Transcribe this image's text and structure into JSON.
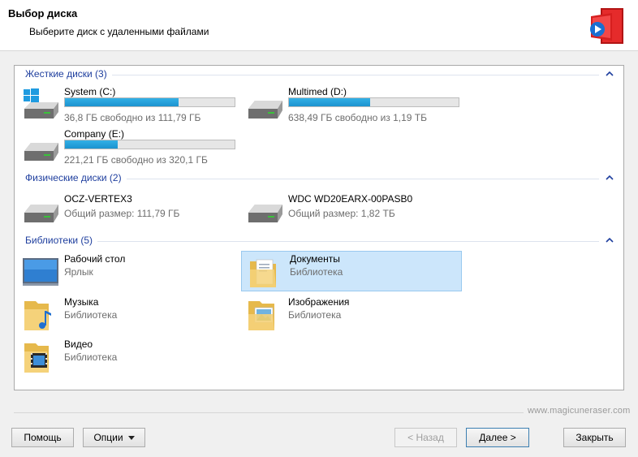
{
  "header": {
    "title": "Выбор диска",
    "subtitle": "Выберите диск с удаленными файлами"
  },
  "groups": {
    "hard": {
      "label": "Жесткие диски (3)",
      "items": [
        {
          "name": "System (C:)",
          "info": "36,8 ГБ свободно из 111,79 ГБ",
          "used_fraction": 0.67,
          "icon": "windows-drive-icon"
        },
        {
          "name": "Multimed (D:)",
          "info": "638,49 ГБ свободно из 1,19 ТБ",
          "used_fraction": 0.48,
          "icon": "hard-drive-icon"
        },
        {
          "name": "Company (E:)",
          "info": "221,21 ГБ свободно из 320,1 ГБ",
          "used_fraction": 0.31,
          "icon": "hard-drive-icon"
        }
      ]
    },
    "physical": {
      "label": "Физические диски (2)",
      "items": [
        {
          "name": "OCZ-VERTEX3",
          "info": "Общий размер: 111,79 ГБ",
          "icon": "hard-drive-icon"
        },
        {
          "name": "WDC WD20EARX-00PASB0",
          "info": "Общий размер: 1,82 ТБ",
          "icon": "hard-drive-icon"
        }
      ]
    },
    "libraries": {
      "label": "Библиотеки (5)",
      "items": [
        {
          "name": "Рабочий стол",
          "info": "Ярлык",
          "icon": "desktop-icon"
        },
        {
          "name": "Документы",
          "info": "Библиотека",
          "icon": "documents-folder-icon",
          "selected": true
        },
        {
          "name": "Музыка",
          "info": "Библиотека",
          "icon": "music-folder-icon"
        },
        {
          "name": "Изображения",
          "info": "Библиотека",
          "icon": "pictures-folder-icon"
        },
        {
          "name": "Видео",
          "info": "Библиотека",
          "icon": "video-folder-icon"
        }
      ]
    }
  },
  "footer": {
    "watermark": "www.magicuneraser.com",
    "help_label": "Помощь",
    "options_label": "Опции",
    "back_label": "< Назад",
    "next_label": "Далее >",
    "close_label": "Закрыть"
  },
  "colors": {
    "group_header": "#1e3e9e",
    "bar_fill": "#26a0da",
    "selection": "#cce6fb"
  }
}
